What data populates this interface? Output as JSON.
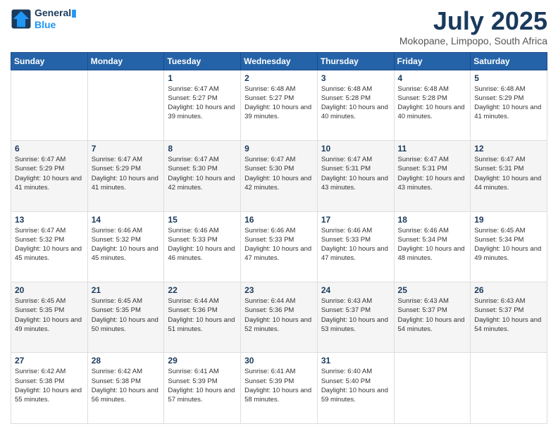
{
  "header": {
    "logo_line1": "General",
    "logo_line2": "Blue",
    "title": "July 2025",
    "subtitle": "Mokopane, Limpopo, South Africa"
  },
  "columns": [
    "Sunday",
    "Monday",
    "Tuesday",
    "Wednesday",
    "Thursday",
    "Friday",
    "Saturday"
  ],
  "weeks": [
    [
      {
        "day": "",
        "info": ""
      },
      {
        "day": "",
        "info": ""
      },
      {
        "day": "1",
        "info": "Sunrise: 6:47 AM\nSunset: 5:27 PM\nDaylight: 10 hours and 39 minutes."
      },
      {
        "day": "2",
        "info": "Sunrise: 6:48 AM\nSunset: 5:27 PM\nDaylight: 10 hours and 39 minutes."
      },
      {
        "day": "3",
        "info": "Sunrise: 6:48 AM\nSunset: 5:28 PM\nDaylight: 10 hours and 40 minutes."
      },
      {
        "day": "4",
        "info": "Sunrise: 6:48 AM\nSunset: 5:28 PM\nDaylight: 10 hours and 40 minutes."
      },
      {
        "day": "5",
        "info": "Sunrise: 6:48 AM\nSunset: 5:29 PM\nDaylight: 10 hours and 41 minutes."
      }
    ],
    [
      {
        "day": "6",
        "info": "Sunrise: 6:47 AM\nSunset: 5:29 PM\nDaylight: 10 hours and 41 minutes."
      },
      {
        "day": "7",
        "info": "Sunrise: 6:47 AM\nSunset: 5:29 PM\nDaylight: 10 hours and 41 minutes."
      },
      {
        "day": "8",
        "info": "Sunrise: 6:47 AM\nSunset: 5:30 PM\nDaylight: 10 hours and 42 minutes."
      },
      {
        "day": "9",
        "info": "Sunrise: 6:47 AM\nSunset: 5:30 PM\nDaylight: 10 hours and 42 minutes."
      },
      {
        "day": "10",
        "info": "Sunrise: 6:47 AM\nSunset: 5:31 PM\nDaylight: 10 hours and 43 minutes."
      },
      {
        "day": "11",
        "info": "Sunrise: 6:47 AM\nSunset: 5:31 PM\nDaylight: 10 hours and 43 minutes."
      },
      {
        "day": "12",
        "info": "Sunrise: 6:47 AM\nSunset: 5:31 PM\nDaylight: 10 hours and 44 minutes."
      }
    ],
    [
      {
        "day": "13",
        "info": "Sunrise: 6:47 AM\nSunset: 5:32 PM\nDaylight: 10 hours and 45 minutes."
      },
      {
        "day": "14",
        "info": "Sunrise: 6:46 AM\nSunset: 5:32 PM\nDaylight: 10 hours and 45 minutes."
      },
      {
        "day": "15",
        "info": "Sunrise: 6:46 AM\nSunset: 5:33 PM\nDaylight: 10 hours and 46 minutes."
      },
      {
        "day": "16",
        "info": "Sunrise: 6:46 AM\nSunset: 5:33 PM\nDaylight: 10 hours and 47 minutes."
      },
      {
        "day": "17",
        "info": "Sunrise: 6:46 AM\nSunset: 5:33 PM\nDaylight: 10 hours and 47 minutes."
      },
      {
        "day": "18",
        "info": "Sunrise: 6:46 AM\nSunset: 5:34 PM\nDaylight: 10 hours and 48 minutes."
      },
      {
        "day": "19",
        "info": "Sunrise: 6:45 AM\nSunset: 5:34 PM\nDaylight: 10 hours and 49 minutes."
      }
    ],
    [
      {
        "day": "20",
        "info": "Sunrise: 6:45 AM\nSunset: 5:35 PM\nDaylight: 10 hours and 49 minutes."
      },
      {
        "day": "21",
        "info": "Sunrise: 6:45 AM\nSunset: 5:35 PM\nDaylight: 10 hours and 50 minutes."
      },
      {
        "day": "22",
        "info": "Sunrise: 6:44 AM\nSunset: 5:36 PM\nDaylight: 10 hours and 51 minutes."
      },
      {
        "day": "23",
        "info": "Sunrise: 6:44 AM\nSunset: 5:36 PM\nDaylight: 10 hours and 52 minutes."
      },
      {
        "day": "24",
        "info": "Sunrise: 6:43 AM\nSunset: 5:37 PM\nDaylight: 10 hours and 53 minutes."
      },
      {
        "day": "25",
        "info": "Sunrise: 6:43 AM\nSunset: 5:37 PM\nDaylight: 10 hours and 54 minutes."
      },
      {
        "day": "26",
        "info": "Sunrise: 6:43 AM\nSunset: 5:37 PM\nDaylight: 10 hours and 54 minutes."
      }
    ],
    [
      {
        "day": "27",
        "info": "Sunrise: 6:42 AM\nSunset: 5:38 PM\nDaylight: 10 hours and 55 minutes."
      },
      {
        "day": "28",
        "info": "Sunrise: 6:42 AM\nSunset: 5:38 PM\nDaylight: 10 hours and 56 minutes."
      },
      {
        "day": "29",
        "info": "Sunrise: 6:41 AM\nSunset: 5:39 PM\nDaylight: 10 hours and 57 minutes."
      },
      {
        "day": "30",
        "info": "Sunrise: 6:41 AM\nSunset: 5:39 PM\nDaylight: 10 hours and 58 minutes."
      },
      {
        "day": "31",
        "info": "Sunrise: 6:40 AM\nSunset: 5:40 PM\nDaylight: 10 hours and 59 minutes."
      },
      {
        "day": "",
        "info": ""
      },
      {
        "day": "",
        "info": ""
      }
    ]
  ]
}
